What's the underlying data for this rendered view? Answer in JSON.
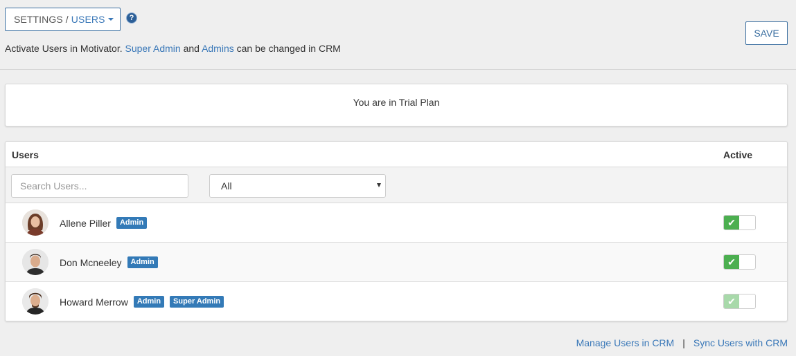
{
  "header": {
    "breadcrumb_settings": "SETTINGS /",
    "breadcrumb_users": "USERS",
    "help_label": "?",
    "save_label": "SAVE",
    "subtitle": {
      "prefix": "Activate Users in Motivator.",
      "super_admin_link": "Super Admin",
      "and": "and",
      "admins_link": "Admins",
      "suffix": "can be changed in CRM"
    }
  },
  "plan_notice": "You are in Trial Plan",
  "users_panel": {
    "column_users": "Users",
    "column_active": "Active",
    "search_placeholder": "Search Users...",
    "filter_selected": "All",
    "rows": [
      {
        "name": "Allene Piller",
        "badges": [
          "Admin"
        ],
        "active": true,
        "disabled": false
      },
      {
        "name": "Don Mcneeley",
        "badges": [
          "Admin"
        ],
        "active": true,
        "disabled": false
      },
      {
        "name": "Howard Merrow",
        "badges": [
          "Admin",
          "Super Admin"
        ],
        "active": true,
        "disabled": true
      }
    ]
  },
  "footer": {
    "manage_link": "Manage Users in CRM",
    "separator": "|",
    "sync_link": "Sync Users with CRM"
  },
  "colors": {
    "accent": "#3a78b8",
    "badge": "#337ab7",
    "toggle_on": "#4caf50",
    "toggle_disabled": "#a8d9aa"
  },
  "icons": {
    "help": "question-circle-icon",
    "caret": "caret-down-icon",
    "check": "check-icon"
  }
}
